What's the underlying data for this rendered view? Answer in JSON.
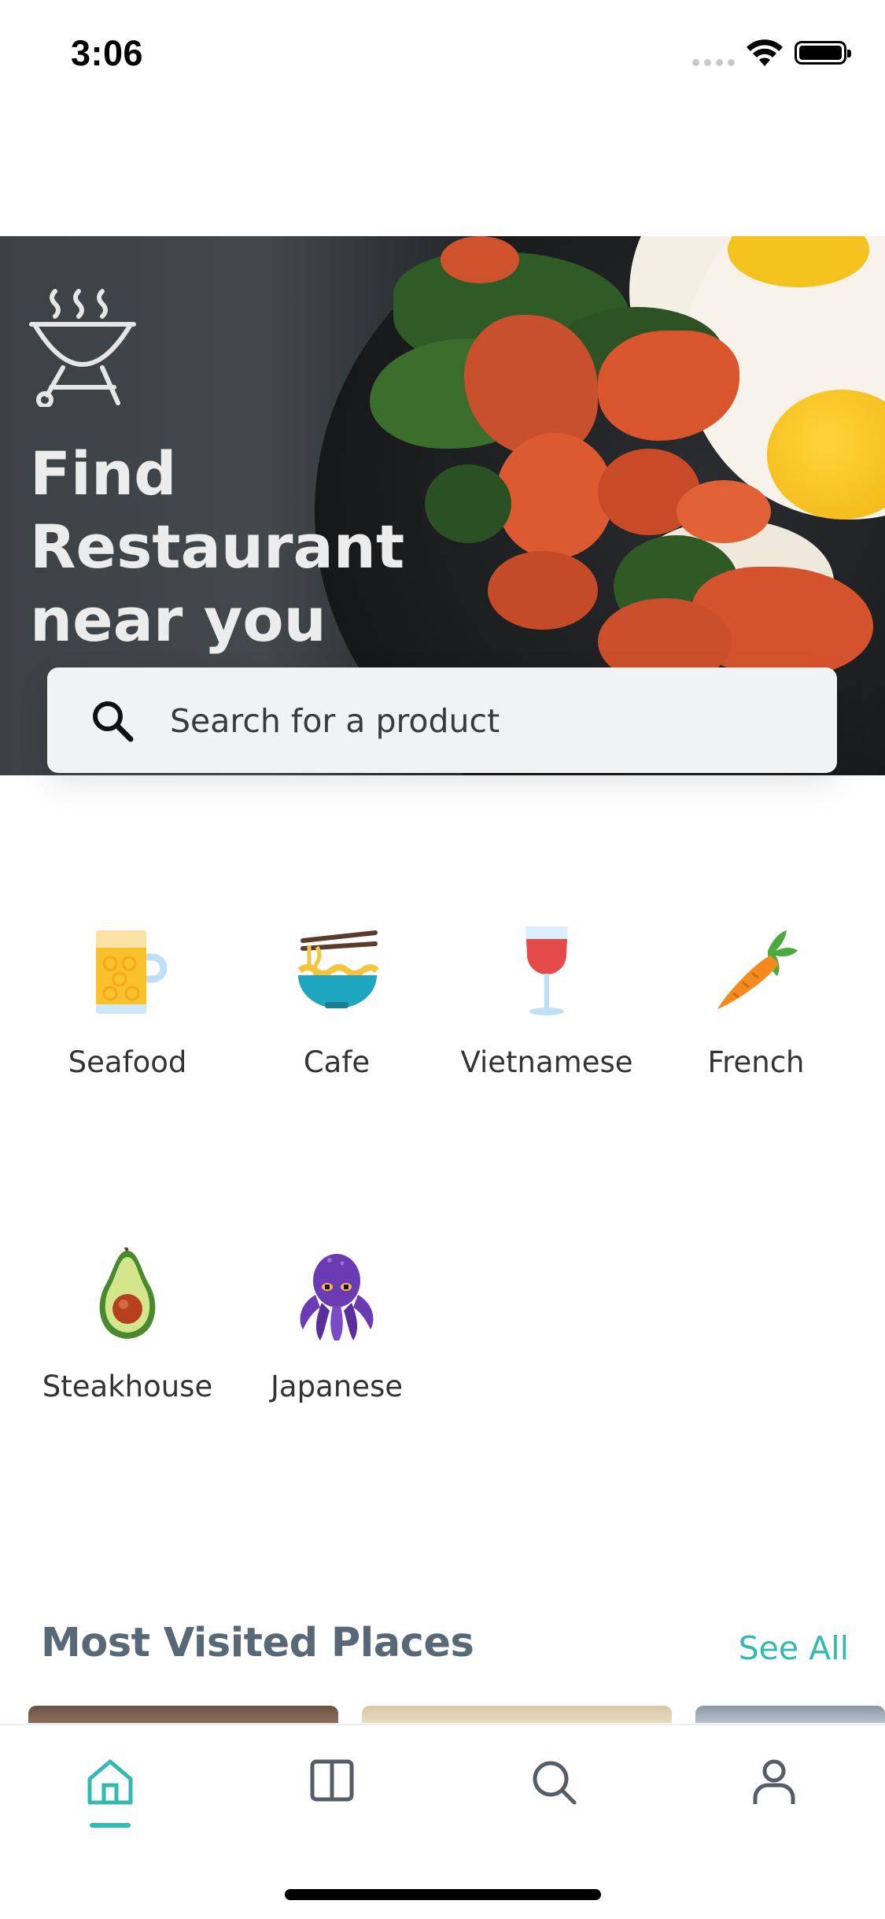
{
  "status_bar": {
    "time": "3:06"
  },
  "hero": {
    "title_lines": [
      "Find",
      "Restaurant",
      "near you"
    ]
  },
  "search": {
    "placeholder": "Search for a product",
    "icon": "search-icon"
  },
  "categories": [
    {
      "label": "Seafood",
      "icon": "beer-mug-icon"
    },
    {
      "label": "Cafe",
      "icon": "noodle-bowl-icon"
    },
    {
      "label": "Vietnamese",
      "icon": "wine-glass-icon"
    },
    {
      "label": "French",
      "icon": "carrot-icon"
    },
    {
      "label": "Steakhouse",
      "icon": "avocado-icon"
    },
    {
      "label": "Japanese",
      "icon": "octopus-icon"
    }
  ],
  "most_visited": {
    "title": "Most Visited Places",
    "see_all": "See All"
  },
  "tab_bar": {
    "items": [
      {
        "name": "home",
        "icon": "home-icon",
        "active": true
      },
      {
        "name": "book",
        "icon": "book-icon",
        "active": false
      },
      {
        "name": "search",
        "icon": "search-icon",
        "active": false
      },
      {
        "name": "profile",
        "icon": "user-icon",
        "active": false
      }
    ]
  },
  "colors": {
    "accent": "#33b9b0",
    "title": "#586876"
  }
}
